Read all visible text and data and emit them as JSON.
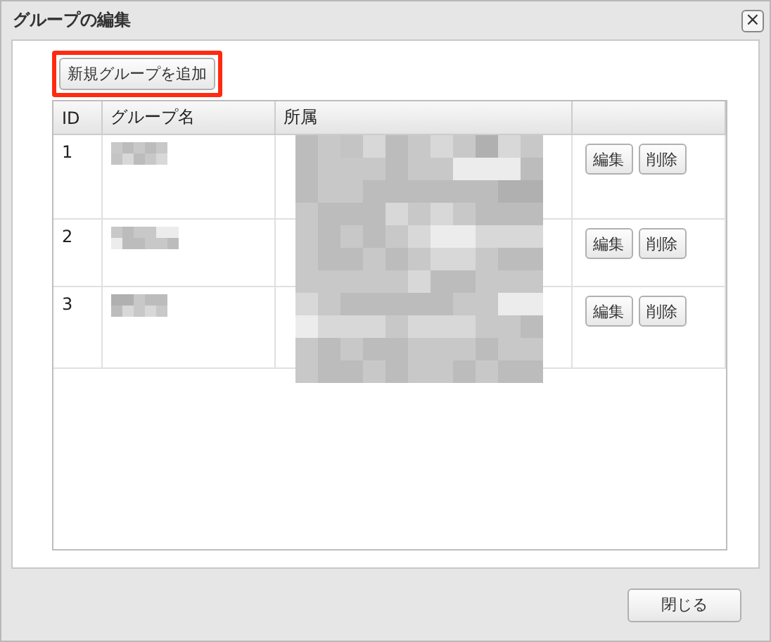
{
  "window": {
    "title": "グループの編集",
    "close_label": "×"
  },
  "add_button": {
    "label": "新規グループを追加",
    "highlighted": true
  },
  "table": {
    "columns": [
      "ID",
      "グループ名",
      "所属"
    ],
    "rows": [
      {
        "id": "1",
        "actions": [
          "編集",
          "削除"
        ]
      },
      {
        "id": "2",
        "actions": [
          "編集",
          "削除"
        ]
      },
      {
        "id": "3",
        "actions": [
          "編集",
          "削除"
        ]
      }
    ]
  },
  "footer": {
    "close_button": "閉じる"
  }
}
